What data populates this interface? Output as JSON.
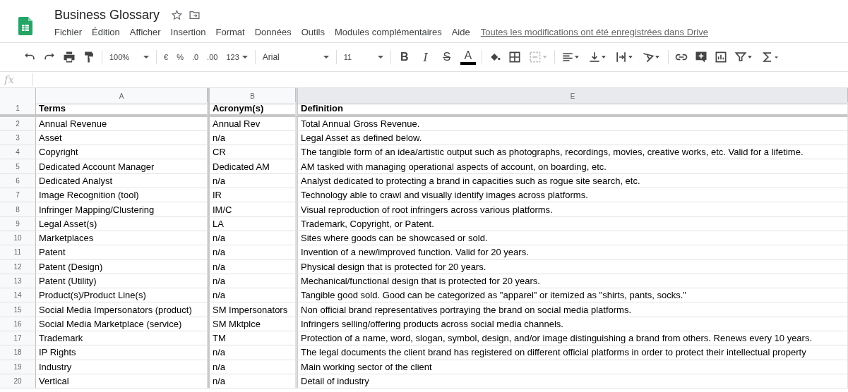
{
  "document": {
    "title": "Business Glossary",
    "menu": [
      "Fichier",
      "Édition",
      "Afficher",
      "Insertion",
      "Format",
      "Données",
      "Outils",
      "Modules complémentaires",
      "Aide"
    ],
    "save_status": "Toutes les modifications ont été enregistrées dans Drive"
  },
  "toolbar": {
    "zoom": "100%",
    "currency": "€",
    "percent": "%",
    "decrease_decimals": ".0",
    "increase_decimals": ".00",
    "more_formats": "123",
    "font": "Arial",
    "font_size": "11",
    "bold": "B",
    "italic": "I",
    "strikethrough": "S",
    "text_color": "A"
  },
  "formula_bar": {
    "label": "fx"
  },
  "table": {
    "columns": [
      "A",
      "B",
      "E"
    ],
    "rows": [
      {
        "number": "1",
        "kind": "header",
        "cells": [
          "Terms",
          "Acronym(s)",
          "Definition"
        ]
      },
      {
        "number": "2",
        "kind": "data",
        "cells": [
          "Annual Revenue",
          "Annual Rev",
          "Total Annual Gross Revenue."
        ]
      },
      {
        "number": "3",
        "kind": "data",
        "cells": [
          "Asset",
          "n/a",
          "Legal Asset as defined below."
        ]
      },
      {
        "number": "4",
        "kind": "data",
        "cells": [
          "Copyright",
          "CR",
          "The tangible form of an idea/artistic output such as photographs, recordings, movies, creative works, etc. Valid for a lifetime."
        ]
      },
      {
        "number": "5",
        "kind": "data",
        "cells": [
          "Dedicated Account Manager",
          "Dedicated AM",
          "AM tasked with managing operational aspects of account, on boarding, etc."
        ]
      },
      {
        "number": "6",
        "kind": "data",
        "cells": [
          "Dedicated Analyst",
          "n/a",
          "Analyst dedicated to protecting a brand in capacities such as rogue site search, etc."
        ]
      },
      {
        "number": "7",
        "kind": "data",
        "cells": [
          "Image Recognition (tool)",
          "IR",
          "Technology able to crawl and visually identify images across platforms."
        ]
      },
      {
        "number": "8",
        "kind": "data",
        "cells": [
          "Infringer Mapping/Clustering",
          "IM/C",
          "Visual reproduction of root infringers across various platforms."
        ]
      },
      {
        "number": "9",
        "kind": "data",
        "cells": [
          "Legal Asset(s)",
          "LA",
          "Trademark, Copyright, or Patent."
        ]
      },
      {
        "number": "10",
        "kind": "data",
        "cells": [
          "Marketplaces",
          "n/a",
          "Sites where goods can be showcased or sold."
        ]
      },
      {
        "number": "11",
        "kind": "data",
        "cells": [
          "Patent",
          "n/a",
          "Invention of a new/improved function. Valid for 20 years."
        ]
      },
      {
        "number": "12",
        "kind": "data",
        "cells": [
          "Patent (Design)",
          "n/a",
          "Physical design that is protected for 20 years."
        ]
      },
      {
        "number": "13",
        "kind": "data",
        "cells": [
          "Patent (Utility)",
          "n/a",
          "Mechanical/functional design that is protected for 20 years."
        ]
      },
      {
        "number": "14",
        "kind": "data",
        "cells": [
          "Product(s)/Product Line(s)",
          "n/a",
          "Tangible good sold. Good can be categorized as \"apparel\" or itemized as \"shirts, pants, socks.\""
        ]
      },
      {
        "number": "15",
        "kind": "data",
        "cells": [
          "Social Media Impersonators (product)",
          "SM Impersonators",
          "Non official brand representatives portraying the brand on social media platforms."
        ]
      },
      {
        "number": "16",
        "kind": "data",
        "cells": [
          "Social Media Marketplace (service)",
          "SM Mktplce",
          "Infringers selling/offering products across social media channels."
        ]
      },
      {
        "number": "17",
        "kind": "data",
        "cells": [
          "Trademark",
          "TM",
          "Protection of a name, word, slogan, symbol, design, and/or image distinguishing a brand from others. Renews every 10 years."
        ]
      },
      {
        "number": "18",
        "kind": "data",
        "cells": [
          "IP Rights",
          "n/a",
          "The legal documents the client brand has registered on different official platforms in order to protect their intellectual property"
        ]
      },
      {
        "number": "19",
        "kind": "data",
        "cells": [
          "Industry",
          "n/a",
          "Main working sector of the client"
        ]
      },
      {
        "number": "20",
        "kind": "data",
        "cells": [
          "Vertical",
          "n/a",
          "Detail of industry"
        ]
      }
    ]
  }
}
